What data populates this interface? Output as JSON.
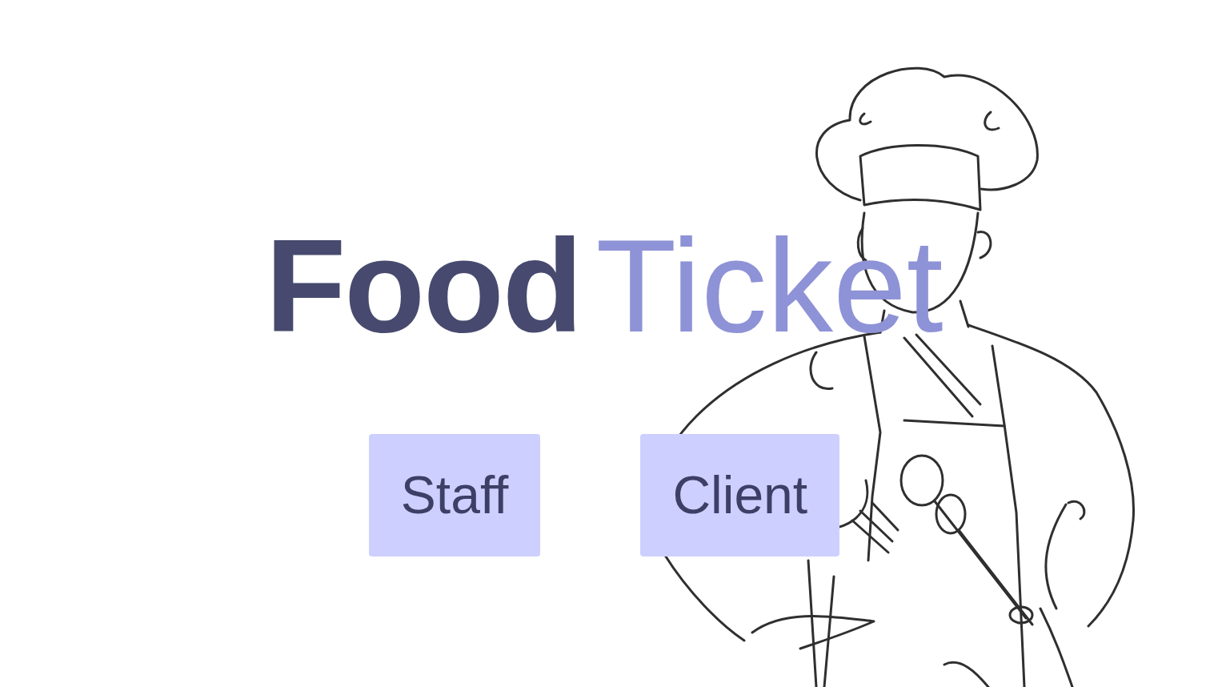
{
  "brand": {
    "first": "Food",
    "second": "Ticket"
  },
  "buttons": [
    {
      "label": "Staff"
    },
    {
      "label": "Client"
    }
  ]
}
